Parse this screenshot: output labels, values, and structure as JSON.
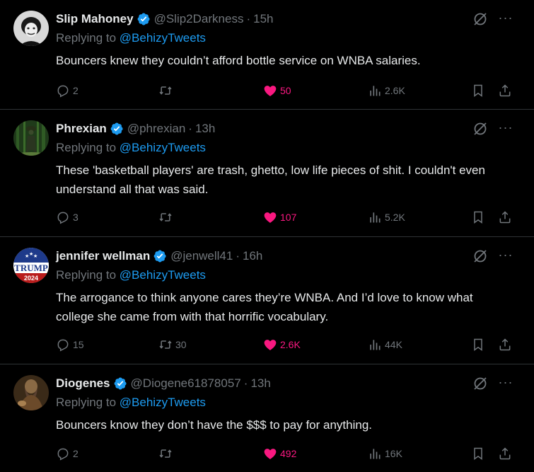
{
  "tweets": [
    {
      "name": "Slip Mahoney",
      "handle": "@Slip2Darkness",
      "time": "15h",
      "replying_prefix": "Replying to ",
      "replying_to": "@BehizyTweets",
      "text": "Bouncers knew they couldn’t afford bottle service on WNBA salaries.",
      "replies": "2",
      "retweets": "",
      "likes": "50",
      "views": "2.6K"
    },
    {
      "name": "Phrexian",
      "handle": "@phrexian",
      "time": "13h",
      "replying_prefix": "Replying to ",
      "replying_to": "@BehizyTweets",
      "text": "These 'basketball players' are trash, ghetto, low life pieces of shit.  I couldn't even understand all that was said.",
      "replies": "3",
      "retweets": "",
      "likes": "107",
      "views": "5.2K"
    },
    {
      "name": "jennifer wellman",
      "handle": "@jenwell41",
      "time": "16h",
      "replying_prefix": "Replying to ",
      "replying_to": "@BehizyTweets",
      "text": "The arrogance to think anyone cares they’re WNBA. And I’d love to know what college she came from with that horrific vocabulary.",
      "replies": "15",
      "retweets": "30",
      "likes": "2.6K",
      "views": "44K",
      "avatar_text": [
        "TRUMP",
        "2024"
      ]
    },
    {
      "name": "Diogenes",
      "handle": "@Diogene61878057",
      "time": "13h",
      "replying_prefix": "Replying to ",
      "replying_to": "@BehizyTweets",
      "text": "Bouncers know they don’t have the $$$ to pay for anything.",
      "replies": "2",
      "retweets": "",
      "likes": "492",
      "views": "16K"
    }
  ],
  "separator": "·",
  "more_label": "···",
  "icons": {
    "verified": "verified-badge-icon",
    "grok": "grok-icon",
    "reply": "reply-icon",
    "retweet": "retweet-icon",
    "like": "heart-icon",
    "views": "views-icon",
    "bookmark": "bookmark-icon",
    "share": "share-icon"
  },
  "colors": {
    "background": "#000000",
    "text": "#e7e9ea",
    "secondary": "#71767b",
    "link": "#1d9bf0",
    "like": "#f91880",
    "verified": "#1d9bf0",
    "divider": "#2f3336"
  }
}
